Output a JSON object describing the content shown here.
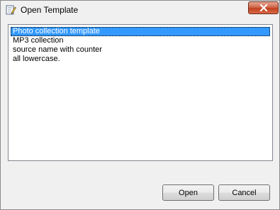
{
  "window": {
    "title": "Open Template",
    "icon": "pencil-document-icon",
    "close_icon": "close-icon"
  },
  "templates": {
    "items": [
      {
        "label": "Photo collection template",
        "selected": true
      },
      {
        "label": "MP3 collection",
        "selected": false
      },
      {
        "label": "source name with counter",
        "selected": false
      },
      {
        "label": "all lowercase.",
        "selected": false
      }
    ]
  },
  "buttons": {
    "open_label": "Open",
    "cancel_label": "Cancel"
  },
  "colors": {
    "selection": "#3399ff",
    "close_button": "#c2401f"
  }
}
